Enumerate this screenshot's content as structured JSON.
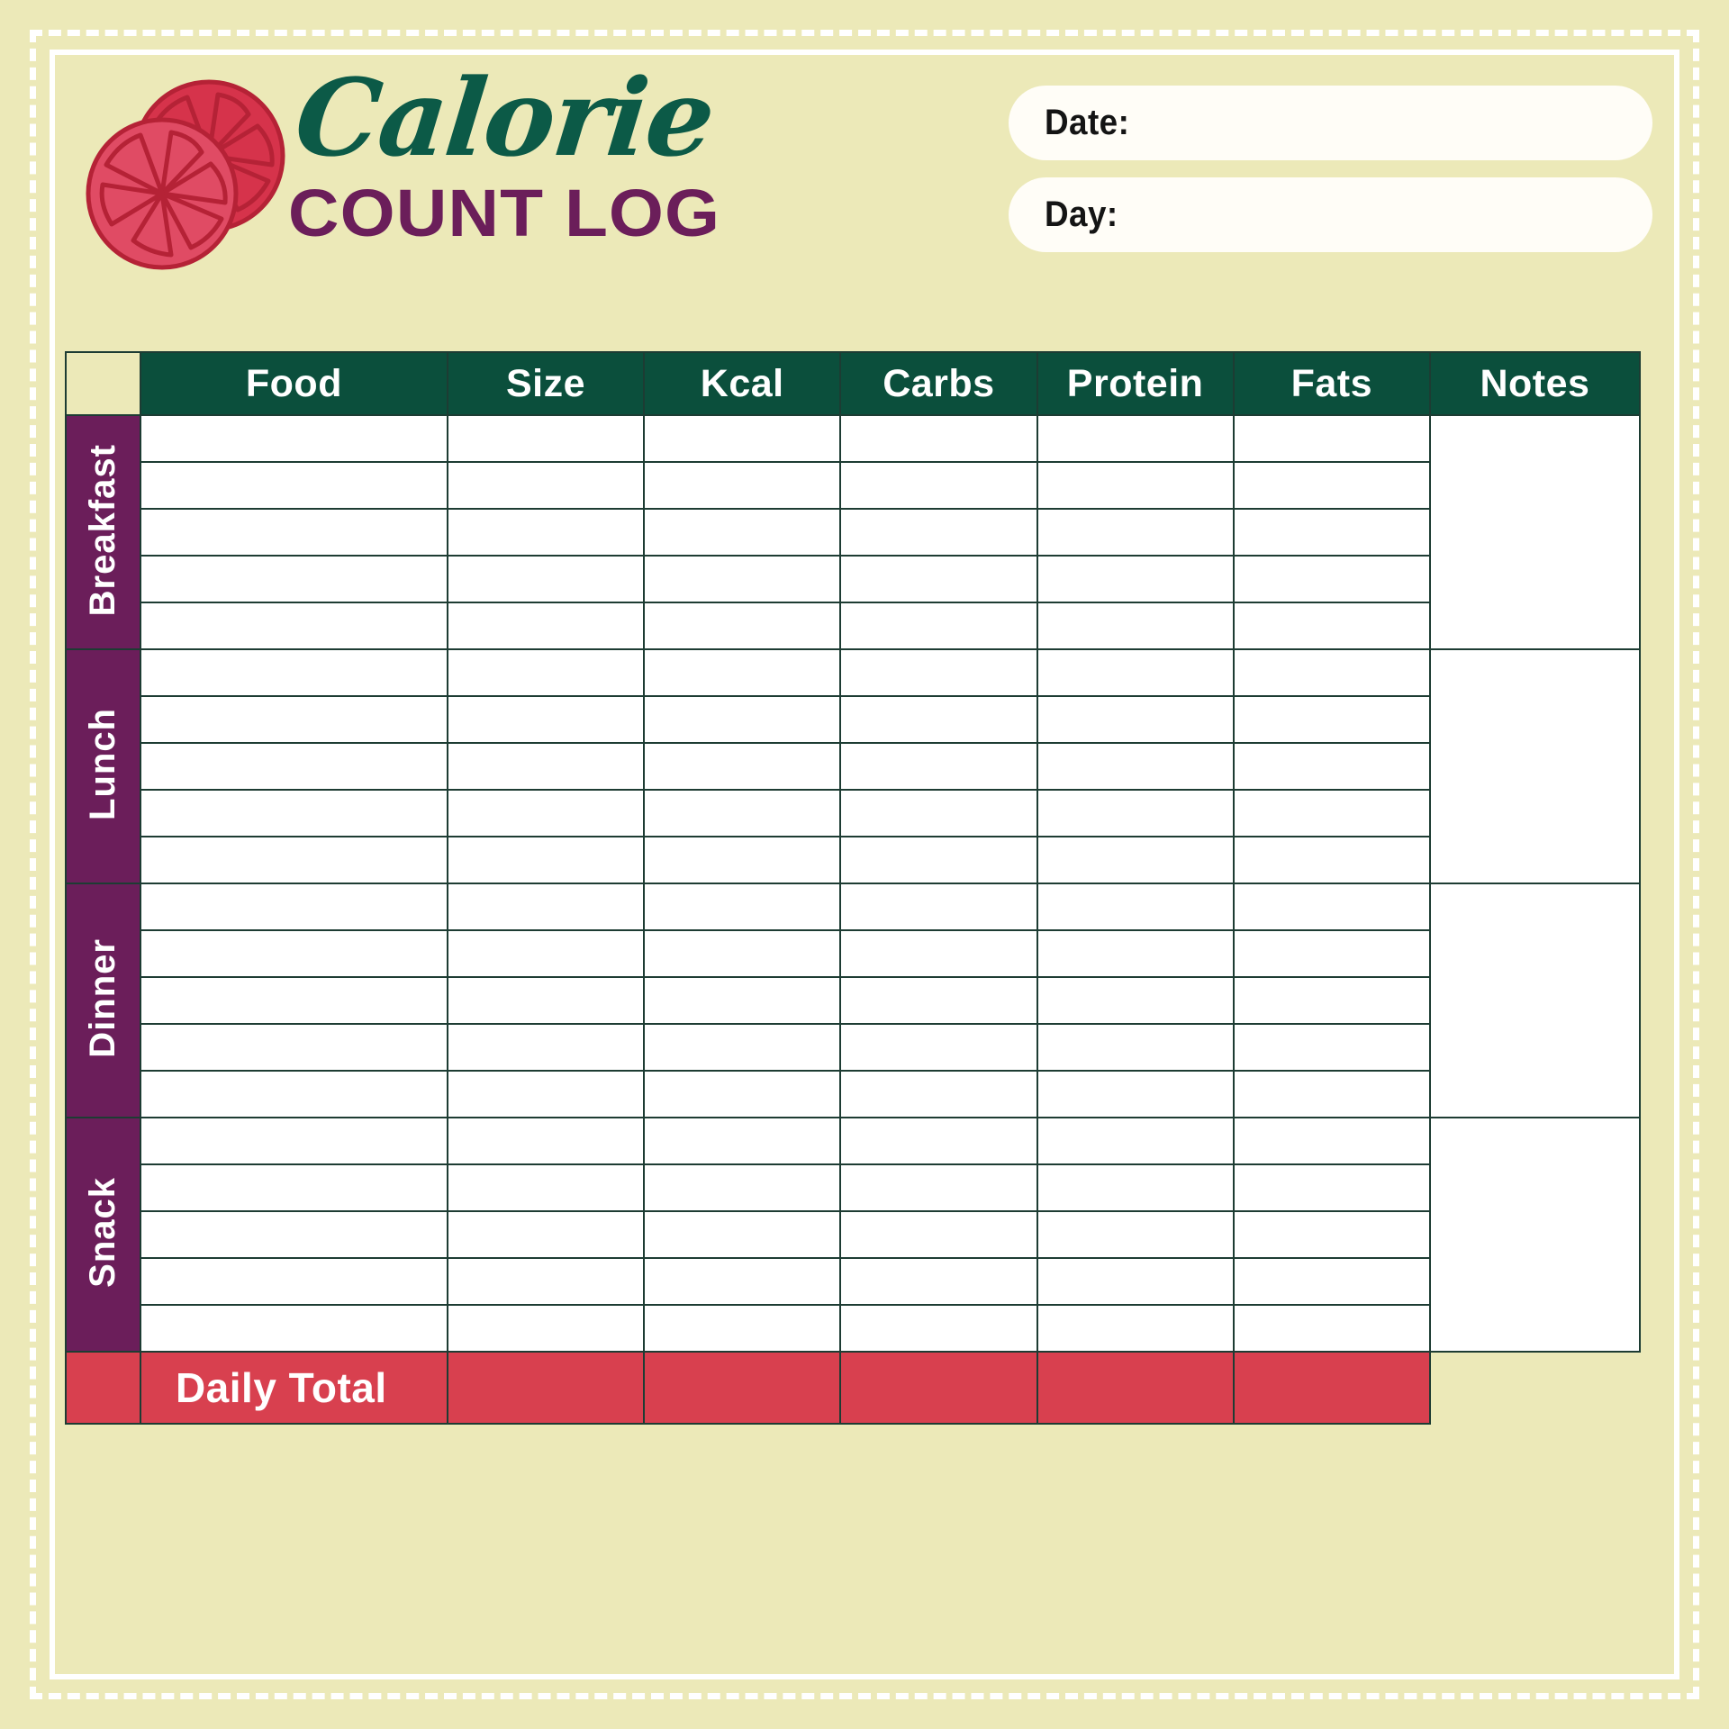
{
  "page": {
    "background_color": "#ece9b8",
    "border_color": "#ffffff"
  },
  "header": {
    "title_script": "Calorie",
    "title_sub": "COUNT LOG",
    "title_script_color": "#0c5a47",
    "title_sub_color": "#6b1e5a",
    "logo_icon": "citrus-slice-icon",
    "logo_color": "#d9425a",
    "fields": [
      {
        "label": "Date:",
        "value": "",
        "placeholder": ""
      },
      {
        "label": "Day:",
        "value": "",
        "placeholder": ""
      }
    ]
  },
  "table": {
    "header_bg": "#0b4f3c",
    "grid_color": "#1d3c33",
    "meal_label_bg": "#6b1e5a",
    "total_bg": "#d8404f",
    "columns": [
      {
        "key": "food",
        "label": "Food"
      },
      {
        "key": "size",
        "label": "Size"
      },
      {
        "key": "kcal",
        "label": "Kcal"
      },
      {
        "key": "carbs",
        "label": "Carbs"
      },
      {
        "key": "protein",
        "label": "Protein"
      },
      {
        "key": "fats",
        "label": "Fats"
      },
      {
        "key": "notes",
        "label": "Notes"
      }
    ],
    "sections": [
      {
        "label": "Breakfast",
        "rows": 5
      },
      {
        "label": "Lunch",
        "rows": 5
      },
      {
        "label": "Dinner",
        "rows": 5
      },
      {
        "label": "Snack",
        "rows": 5
      }
    ],
    "total_label": "Daily Total"
  }
}
